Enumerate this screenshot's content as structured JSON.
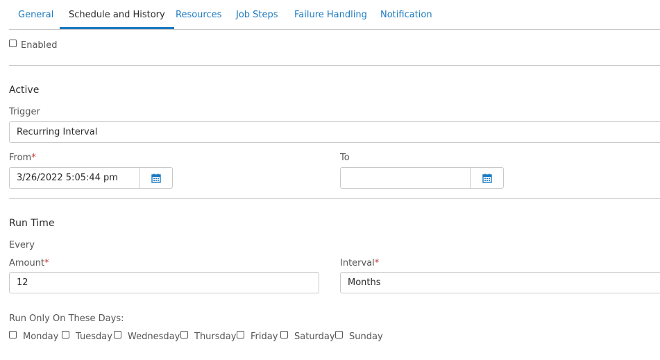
{
  "tabs": [
    {
      "label": "General",
      "active": false
    },
    {
      "label": "Schedule and History",
      "active": true
    },
    {
      "label": "Resources",
      "active": false
    },
    {
      "label": "Job Steps",
      "active": false
    },
    {
      "label": "Failure Handling",
      "active": false
    },
    {
      "label": "Notification",
      "active": false
    }
  ],
  "enabled": {
    "label": "Enabled",
    "checked": false
  },
  "active_section": {
    "title": "Active",
    "trigger": {
      "label": "Trigger",
      "value": "Recurring Interval"
    },
    "from": {
      "label": "From",
      "required": "*",
      "value": "3/26/2022 5:05:44 pm"
    },
    "to": {
      "label": "To",
      "value": ""
    }
  },
  "run_time": {
    "title": "Run Time",
    "every_label": "Every",
    "amount": {
      "label": "Amount",
      "required": "*",
      "value": "12"
    },
    "interval": {
      "label": "Interval",
      "required": "*",
      "value": "Months"
    },
    "days_label": "Run Only On These Days:",
    "days": [
      {
        "label": "Monday",
        "checked": false
      },
      {
        "label": "Tuesday",
        "checked": false
      },
      {
        "label": "Wednesday",
        "checked": false
      },
      {
        "label": "Thursday",
        "checked": false
      },
      {
        "label": "Friday",
        "checked": false
      },
      {
        "label": "Saturday",
        "checked": false
      },
      {
        "label": "Sunday",
        "checked": false
      }
    ]
  },
  "colors": {
    "accent": "#1b7ac0",
    "required": "#c23934",
    "border": "#c9c9c9"
  },
  "icons": {
    "calendar": "calendar-icon"
  }
}
